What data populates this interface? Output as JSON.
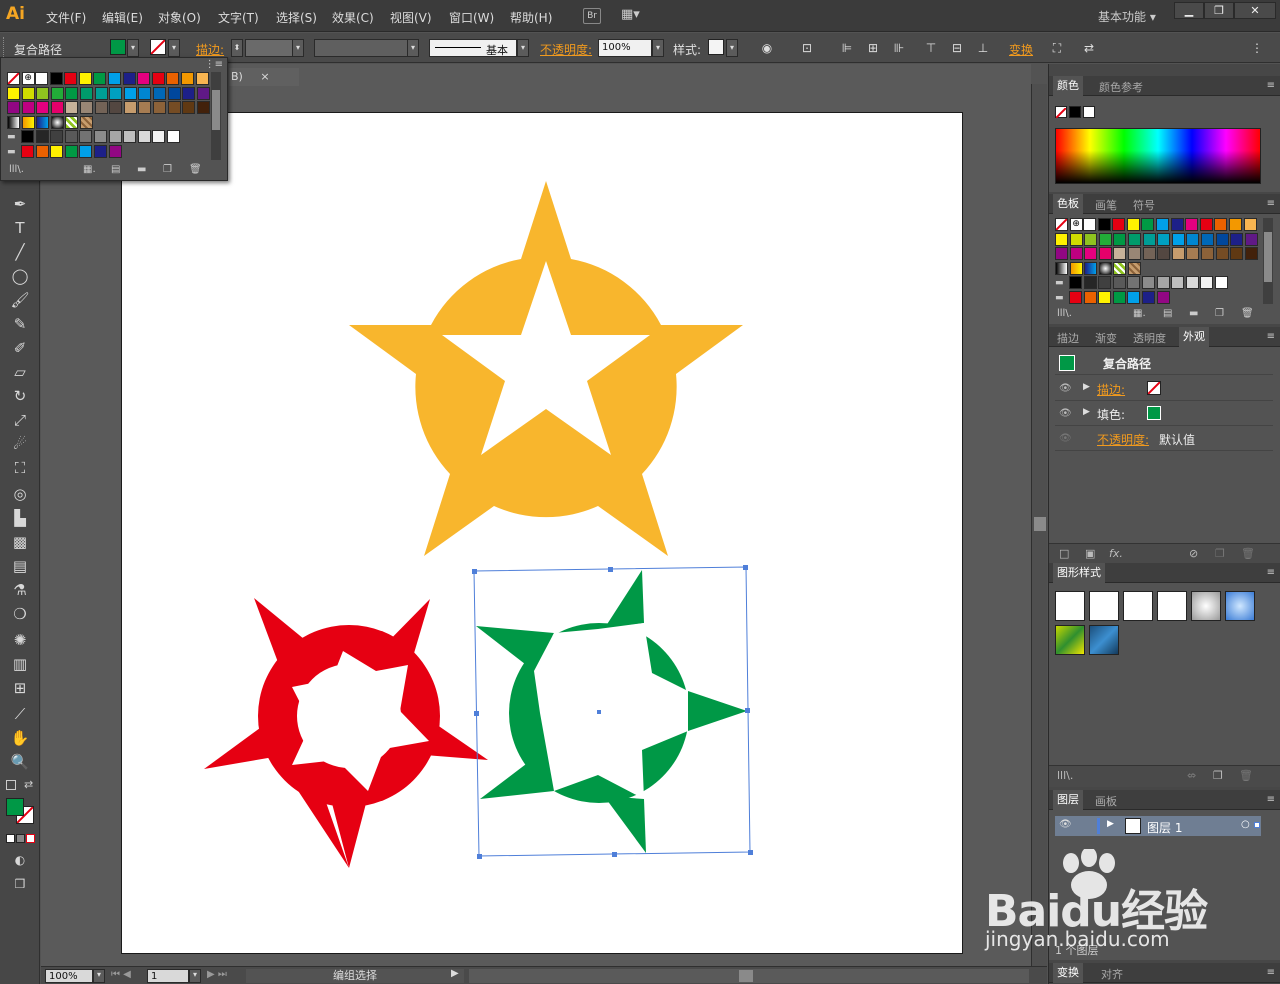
{
  "app": {
    "logo": "Ai",
    "workspace": "基本功能",
    "bridge_label": "Br"
  },
  "menu": [
    "文件(F)",
    "编辑(E)",
    "对象(O)",
    "文字(T)",
    "选择(S)",
    "效果(C)",
    "视图(V)",
    "窗口(W)",
    "帮助(H)"
  ],
  "control_bar": {
    "object_type": "复合路径",
    "stroke_label": "描边:",
    "stroke_style": "基本",
    "opacity_label": "不透明度:",
    "opacity_value": "100%",
    "style_label": "样式:",
    "transform_label": "变换"
  },
  "document_tab": {
    "close": "×",
    "partial_label": "B)"
  },
  "status_bar": {
    "zoom": "100%",
    "artboard_number": "1",
    "status_text": "编组选择"
  },
  "colors": {
    "fill": "#009846",
    "orange": "#f8b62d",
    "red": "#e60012",
    "green": "#009846",
    "accent_link": "#f19a1e"
  },
  "panels": {
    "color": {
      "tabs": [
        "颜色",
        "颜色参考"
      ]
    },
    "swatches": {
      "tabs": [
        "色板",
        "画笔",
        "符号"
      ]
    },
    "appearance": {
      "tabs": [
        "描边",
        "渐变",
        "透明度",
        "外观"
      ],
      "title": "复合路径",
      "rows": [
        {
          "label": "描边:",
          "kind": "stroke"
        },
        {
          "label": "填色:",
          "kind": "fill"
        },
        {
          "label": "不透明度:",
          "value": "默认值"
        }
      ]
    },
    "graphic_styles": {
      "tabs": [
        "图形样式"
      ]
    },
    "layers": {
      "tabs": [
        "图层",
        "画板"
      ],
      "layer_name": "图层 1",
      "count_text": "1 个图层"
    },
    "bottom": {
      "tabs": [
        "变换",
        "对齐"
      ]
    }
  },
  "watermark": {
    "line1": "Baidu经验",
    "line2": "jingyan.baidu.com"
  },
  "swatch_colors": {
    "row1": [
      "#ffffff",
      "#000000",
      "#e60012",
      "#fff100",
      "#009944",
      "#00a0e9",
      "#1d2088",
      "#e4007f",
      "#e60012",
      "#eb6100",
      "#f39800",
      "#f8b551"
    ],
    "row2": [
      "#fff100",
      "#cfdb00",
      "#8fc31f",
      "#22ac38",
      "#009944",
      "#009b6b",
      "#009e96",
      "#00a0c1",
      "#00a0e9",
      "#0086d1",
      "#0068b7",
      "#00479d",
      "#1d2088",
      "#601986"
    ],
    "row3": [
      "#920783",
      "#be0081",
      "#e4007f",
      "#e5006a",
      "#c7b299",
      "#998675",
      "#736357",
      "#534741",
      "#c69c6d",
      "#a67c52",
      "#8c6239",
      "#754c24",
      "#603913",
      "#42210b"
    ],
    "gray": [
      "#000000",
      "#262626",
      "#404040",
      "#595959",
      "#737373",
      "#8c8c8c",
      "#a6a6a6",
      "#bfbfbf",
      "#d9d9d9",
      "#f2f2f2",
      "#ffffff"
    ],
    "group": [
      "#e60012",
      "#eb6100",
      "#fff100",
      "#009944",
      "#00a0e9",
      "#1d2088",
      "#920783"
    ]
  }
}
